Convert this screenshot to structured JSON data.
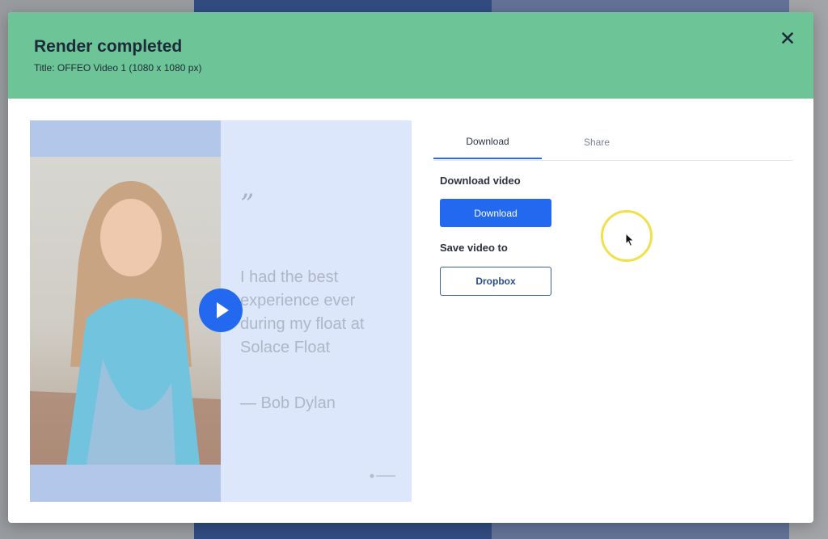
{
  "modal": {
    "title": "Render completed",
    "subtitle": "Title: OFFEO Video 1 (1080 x 1080 px)",
    "close_icon": "close-icon",
    "header_color": "#6cc497"
  },
  "preview": {
    "quote_mark": "”",
    "quote_text": "I had the best experience ever during my float at Solace Float",
    "author": "— Bob Dylan",
    "play_icon": "play-icon",
    "play_color": "#2269f0"
  },
  "tabs": [
    {
      "label": "Download",
      "active": true
    },
    {
      "label": "Share",
      "active": false
    }
  ],
  "download": {
    "section_title": "Download video",
    "button_label": "Download",
    "button_color": "#2269f0"
  },
  "save": {
    "section_title": "Save video to",
    "dropbox_label": "Dropbox"
  }
}
